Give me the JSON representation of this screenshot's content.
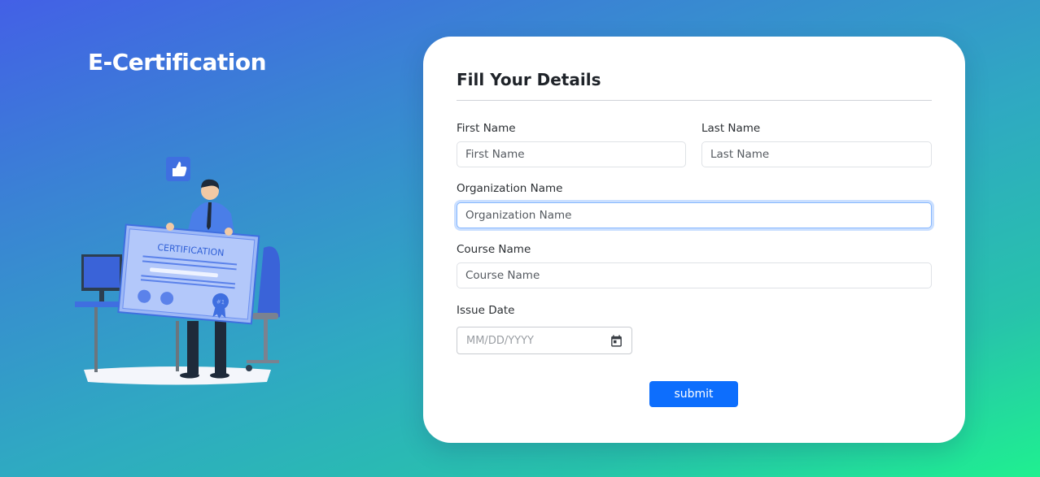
{
  "brand": {
    "title": "E-Certification"
  },
  "illustration": {
    "certificate_text": "CERTIFICATION",
    "badge_text": "#1"
  },
  "form": {
    "title": "Fill Your Details",
    "first_name": {
      "label": "First Name",
      "placeholder": "First Name",
      "value": ""
    },
    "last_name": {
      "label": "Last Name",
      "placeholder": "Last Name",
      "value": ""
    },
    "organization": {
      "label": "Organization Name",
      "placeholder": "Organization Name",
      "value": ""
    },
    "course": {
      "label": "Course Name",
      "placeholder": "Course Name",
      "value": ""
    },
    "issue_date": {
      "label": "Issue Date",
      "placeholder": "MM/DD/YYYY",
      "icon": "calendar-icon"
    },
    "submit_label": "submit"
  },
  "colors": {
    "primary": "#0d6efd",
    "focus_border": "#86b7fe",
    "card_bg": "#ffffff"
  }
}
